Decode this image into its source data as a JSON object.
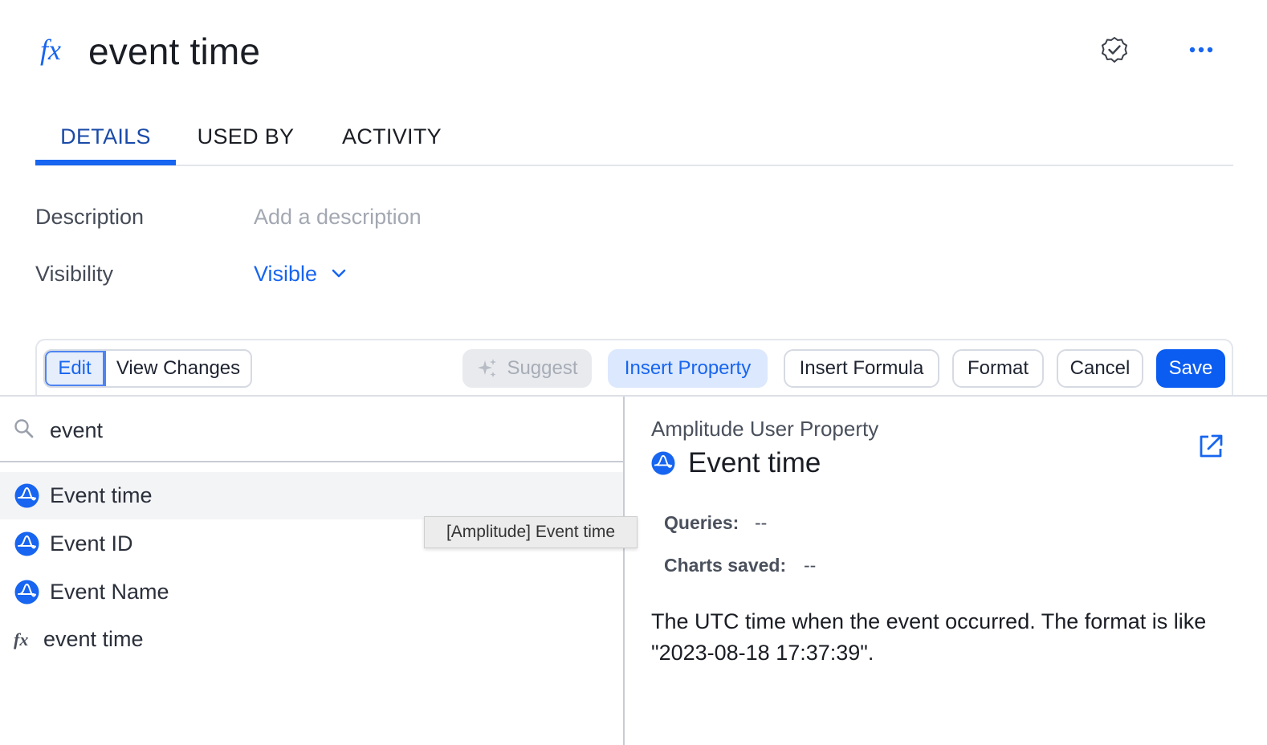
{
  "header": {
    "title": "event time",
    "logo_icon": "fx-icon",
    "verified_icon": "check-badge-icon",
    "more_icon": "more-horizontal-icon"
  },
  "tabs": [
    {
      "label": "DETAILS",
      "active": true
    },
    {
      "label": "USED BY",
      "active": false
    },
    {
      "label": "ACTIVITY",
      "active": false
    }
  ],
  "fields": {
    "description_label": "Description",
    "description_placeholder": "Add a description",
    "visibility_label": "Visibility",
    "visibility_value": "Visible"
  },
  "toolbar": {
    "edit_label": "Edit",
    "view_changes_label": "View Changes",
    "suggest_label": "Suggest",
    "insert_property_label": "Insert Property",
    "insert_formula_label": "Insert Formula",
    "format_label": "Format",
    "cancel_label": "Cancel",
    "save_label": "Save"
  },
  "search": {
    "value": "event",
    "icon": "search-icon"
  },
  "results": [
    {
      "label": "Event time",
      "icon": "amplitude-icon"
    },
    {
      "label": "Event ID",
      "icon": "amplitude-icon"
    },
    {
      "label": "Event Name",
      "icon": "amplitude-icon"
    },
    {
      "label": "event time",
      "icon": "fx-icon"
    }
  ],
  "tooltip": "[Amplitude] Event time",
  "details": {
    "kind": "Amplitude User Property",
    "name": "Event time",
    "queries_label": "Queries:",
    "queries_value": "--",
    "charts_label": "Charts saved:",
    "charts_value": "--",
    "description": "The UTC time when the event occurred. The format is like \"2023-08-18 17:37:39\"."
  },
  "colors": {
    "accent": "#1765f0",
    "tab_active": "#1a4aa8",
    "save_bg": "#0b5cf0",
    "insert_property_bg": "#dce8fd"
  }
}
